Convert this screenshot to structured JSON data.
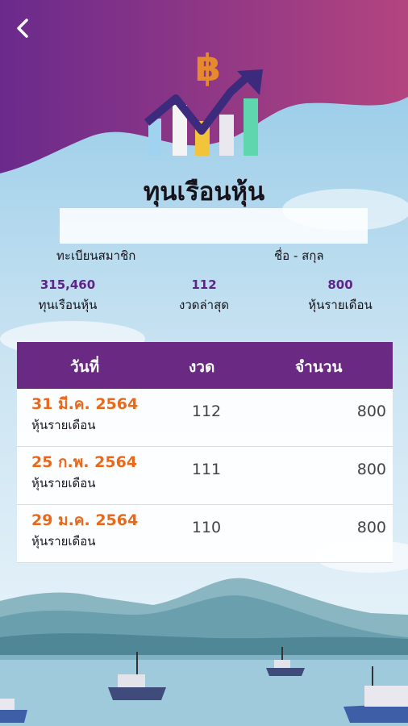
{
  "header": {
    "title": "ทุนเรือนหุ้น",
    "back_icon": "chevron-left-icon"
  },
  "member": {
    "id_label": "ทะเบียนสมาชิก",
    "name_label": "ชื่อ - สกุล"
  },
  "stats": [
    {
      "value": "315,460",
      "label": "ทุนเรือนหุ้น"
    },
    {
      "value": "112",
      "label": "งวดล่าสุด"
    },
    {
      "value": "800",
      "label": "หุ้นรายเดือน"
    }
  ],
  "table": {
    "headers": {
      "date": "วันที่",
      "period": "งวด",
      "amount": "จำนวน"
    },
    "rows": [
      {
        "date": "31 มี.ค. 2564",
        "type": "หุ้นรายเดือน",
        "period": "112",
        "amount": "800"
      },
      {
        "date": "25 ก.พ. 2564",
        "type": "หุ้นรายเดือน",
        "period": "111",
        "amount": "800"
      },
      {
        "date": "29 ม.ค. 2564",
        "type": "หุ้นรายเดือน",
        "period": "110",
        "amount": "800"
      }
    ]
  },
  "colors": {
    "primary": "#6a2a84",
    "accent": "#e8691b",
    "stat": "#5e2589"
  }
}
